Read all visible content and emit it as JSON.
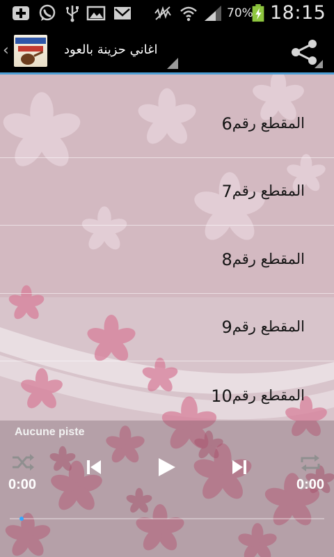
{
  "status_bar": {
    "icons": [
      "add-icon",
      "whatsapp-icon",
      "usb-icon",
      "picture-icon",
      "mail-icon",
      "mute-icon",
      "wifi-icon",
      "signal-icon",
      "battery-icon"
    ],
    "battery_percent": "70%",
    "time": "18:15"
  },
  "action_bar": {
    "title": "اغاني حزينة بالعود",
    "icons": [
      "chevron-left-icon",
      "app-logo-icon",
      "share-icon"
    ],
    "accent_color": "#4d9fd6"
  },
  "tracks": [
    {
      "word": "المقطع رقم",
      "number": "6"
    },
    {
      "word": "المقطع رقم",
      "number": "7"
    },
    {
      "word": "المقطع رقم",
      "number": "8"
    },
    {
      "word": "المقطع رقم",
      "number": "9"
    },
    {
      "word": "المقطع رقم",
      "number": "10"
    }
  ],
  "player": {
    "status": "Aucune piste",
    "elapsed": "0:00",
    "total": "0:00",
    "progress_fraction": 0.0,
    "icons": [
      "shuffle-icon",
      "previous-icon",
      "play-icon",
      "next-icon",
      "repeat-icon"
    ],
    "seek_color": "#35a7ff"
  }
}
